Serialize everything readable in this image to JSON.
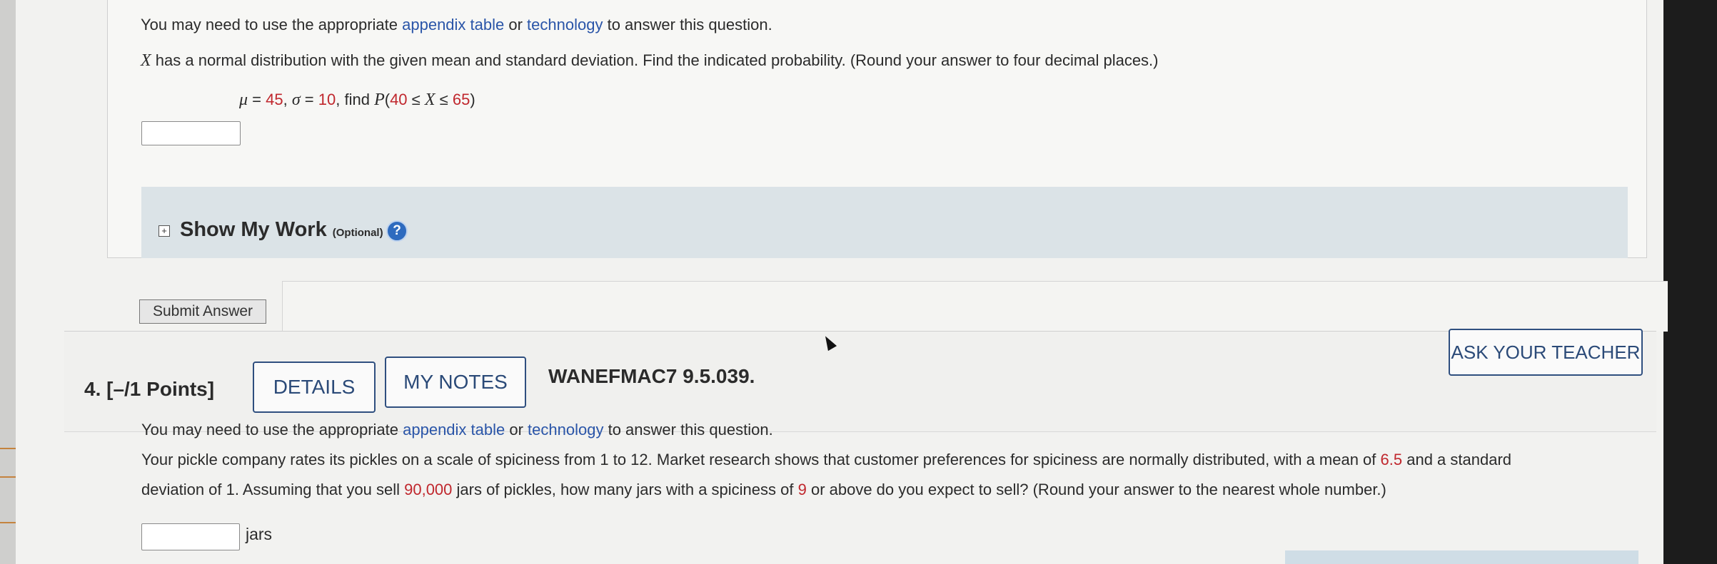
{
  "question3": {
    "intro_pre": "You may need to use the appropriate ",
    "intro_link1": "appendix table",
    "intro_or": " or ",
    "intro_link2": "technology",
    "intro_post": " to answer this question.",
    "var": "X",
    "problem": " has a normal distribution with the given mean and standard deviation. Find the indicated probability. (Round your answer to four decimal places.)",
    "mu_sym": "μ",
    "mu_eq": " = ",
    "mu_val": "45",
    "sep": ", ",
    "sigma_sym": "σ",
    "sigma_eq": " = ",
    "sigma_val": "10",
    "find": ", find ",
    "prob_p": "P",
    "prob_open": "(",
    "prob_low": "40",
    "prob_le1": " ≤ ",
    "prob_x": "X",
    "prob_le2": " ≤ ",
    "prob_high": "65",
    "prob_close": ")",
    "answer": ""
  },
  "show_my_work": {
    "icon": "plus-box-icon",
    "title": "Show My Work ",
    "optional": "(Optional)",
    "help_icon": "help-circle-icon",
    "help_glyph": "?"
  },
  "submit_label": "Submit Answer",
  "question4": {
    "number": "4.  [–/1 Points]",
    "details_label": "DETAILS",
    "notes_label": "MY NOTES",
    "code": "WANEFMAC7 9.5.039.",
    "ask_label": "ASK YOUR TEACHER",
    "intro_pre": "You may need to use the appropriate ",
    "intro_link1": "appendix table",
    "intro_or": " or ",
    "intro_link2": "technology",
    "intro_post": " to answer this question.",
    "p1a": "Your pickle company rates its pickles on a scale of spiciness from 1 to 12. Market research shows that customer preferences for spiciness are normally distributed, with a mean of ",
    "mean": "6.5",
    "p1b": " and a standard",
    "p2a": "deviation of 1. Assuming that you sell ",
    "jars_sold": "90,000",
    "p2b": " jars of pickles, how many jars with a spiciness of ",
    "threshold": "9",
    "p2c": " or above do you expect to sell? (Round your answer to the nearest whole number.)",
    "answer": "",
    "unit": "jars"
  },
  "colors": {
    "link": "#2a55a8",
    "highlight": "#c0272d",
    "button_border": "#2f4f7f"
  }
}
